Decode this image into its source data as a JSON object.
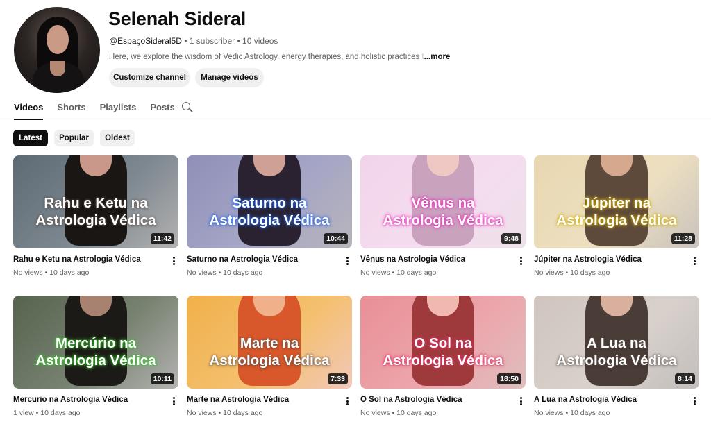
{
  "channel": {
    "name": "Selenah Sideral",
    "handle": "@EspaçoSideral5D",
    "subscribers": "1 subscriber",
    "videos_count": "10 videos",
    "description": "Here, we explore the wisdom of Vedic Astrology, energy therapies, and holistic practices",
    "description_fade": " t",
    "more_label": "...more",
    "separator": " • "
  },
  "buttons": {
    "customize": "Customize channel",
    "manage": "Manage videos"
  },
  "tabs": [
    "Videos",
    "Shorts",
    "Playlists",
    "Posts"
  ],
  "active_tab": "Videos",
  "chips": [
    "Latest",
    "Popular",
    "Oldest"
  ],
  "active_chip": "Latest",
  "videos": [
    {
      "title": "Rahu e Ketu na Astrologia Védica",
      "caption_line1": "Rahu e Ketu na",
      "caption_line2": "Astrologia Védica",
      "duration": "11:42",
      "views": "No views",
      "age": "10 days ago",
      "bg": "#5d6a74",
      "figure": "#1a1614",
      "face": "#c9988a"
    },
    {
      "title": "Saturno na Astrologia Védica",
      "caption_line1": "Saturno na",
      "caption_line2": "Astrologia Védica",
      "duration": "10:44",
      "views": "No views",
      "age": "10 days ago",
      "bg": "#8f8fb8",
      "figure": "#2a2230",
      "face": "#cfa095"
    },
    {
      "title": "Vênus na Astrologia Védica",
      "caption_line1": "Vênus na",
      "caption_line2": "Astrologia Védica",
      "duration": "9:48",
      "views": "No views",
      "age": "10 days ago",
      "bg": "#f2d4ea",
      "figure": "#c9a2be",
      "face": "#efc8c4"
    },
    {
      "title": "Júpiter na Astrologia Védica",
      "caption_line1": "Júpiter na",
      "caption_line2": "Astrologia Védica",
      "duration": "11:28",
      "views": "No views",
      "age": "10 days ago",
      "bg": "#e8d7b0",
      "figure": "#5e4a3a",
      "face": "#d6a88e"
    },
    {
      "title": "Mercurio na Astrologia Védica",
      "caption_line1": "Mercúrio na",
      "caption_line2": "Astrologia Védica",
      "duration": "10:11",
      "views": "1 view",
      "age": "10 days ago",
      "bg": "#56634e",
      "figure": "#1c1a16",
      "face": "#a88270"
    },
    {
      "title": "Marte na Astrologia Védica",
      "caption_line1": "Marte na",
      "caption_line2": "Astrologia Védica",
      "duration": "7:33",
      "views": "No views",
      "age": "10 days ago",
      "bg": "#f1b04a",
      "figure": "#d8582c",
      "face": "#efb08a"
    },
    {
      "title": "O Sol na Astrologia Védica",
      "caption_line1": "O Sol na",
      "caption_line2": "Astrologia Védica",
      "duration": "18:50",
      "views": "No views",
      "age": "10 days ago",
      "bg": "#e88f96",
      "figure": "#9e3a3c",
      "face": "#f0b8ae"
    },
    {
      "title": "A Lua na Astrologia Védica",
      "caption_line1": "A Lua na",
      "caption_line2": "Astrologia Védica",
      "duration": "8:14",
      "views": "No views",
      "age": "10 days ago",
      "bg": "#cfc5be",
      "figure": "#4a3c36",
      "face": "#d9b09e"
    }
  ],
  "caption_glows": [
    "white",
    "blue",
    "pink",
    "yellow",
    "green",
    "white",
    "red",
    "white"
  ],
  "icons": {
    "search": "search-icon",
    "more": "more-vert-icon"
  }
}
